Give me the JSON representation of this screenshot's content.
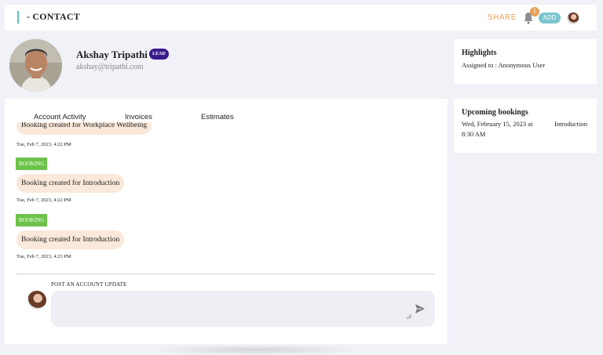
{
  "topbar": {
    "title": "- CONTACT",
    "share_label": "SHARE",
    "notification_count": "1",
    "add_label": "ADD"
  },
  "profile": {
    "name": "Akshay Tripathi",
    "badge": "LEAD",
    "email": "akshay@tripathi.com"
  },
  "highlights": {
    "title": "Highlights",
    "assigned": "Assigned to : Anonymous User"
  },
  "upcoming": {
    "title": "Upcoming bookings",
    "date_line1": "Wed, February 15, 2023 at",
    "date_line2": "8:30 AM",
    "event": "Introduction"
  },
  "tabs": [
    "Account Activity",
    "Invoices",
    "Estimates"
  ],
  "activity": [
    {
      "text": "Booking created for Workplace Wellbeing",
      "timestamp": "Tue, Feb 7, 2023, 4:22 PM"
    },
    {
      "tag": "BOOKING",
      "text": "Booking created for Introduction",
      "timestamp": "Tue, Feb 7, 2023, 4:22 PM"
    },
    {
      "tag": "BOOKING",
      "text": "Booking created for Introduction",
      "timestamp": "Tue, Feb 7, 2023, 4:23 PM"
    }
  ],
  "post": {
    "label": "POST AN ACCOUNT UPDATE",
    "placeholder": ""
  },
  "colors": {
    "accent": "#59c2c4",
    "share": "#e6a15a",
    "lead_badge": "#3a1a8a",
    "booking_tag": "#6cc24a",
    "bubble": "#fae8da"
  }
}
